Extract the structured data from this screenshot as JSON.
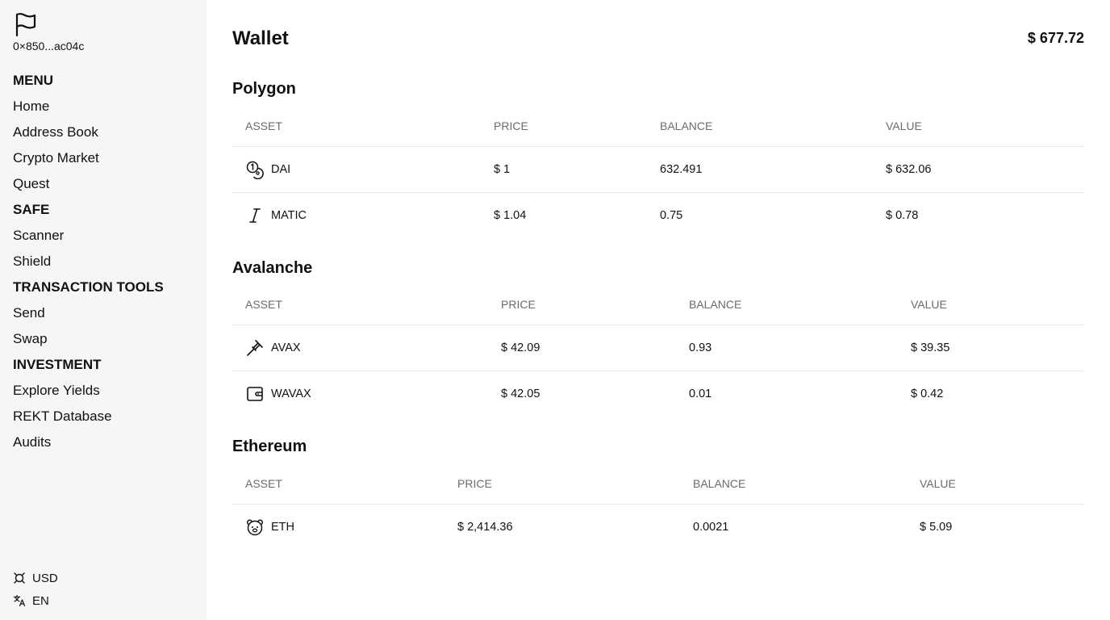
{
  "sidebar": {
    "address": "0×850...ac04c",
    "sections": [
      {
        "heading": "MENU",
        "items": [
          "Home",
          "Address Book",
          "Crypto Market",
          "Quest"
        ]
      },
      {
        "heading": "SAFE",
        "items": [
          "Scanner",
          "Shield"
        ]
      },
      {
        "heading": "TRANSACTION TOOLS",
        "items": [
          "Send",
          "Swap"
        ]
      },
      {
        "heading": "INVESTMENT",
        "items": [
          "Explore Yields",
          "REKT Database",
          "Audits"
        ]
      }
    ],
    "currency": "USD",
    "language": "EN"
  },
  "main": {
    "title": "Wallet",
    "total": "$ 677.72",
    "columns": {
      "asset": "ASSET",
      "price": "PRICE",
      "balance": "BALANCE",
      "value": "VALUE"
    },
    "chains": [
      {
        "name": "Polygon",
        "rows": [
          {
            "icon": "coins-icon",
            "asset": "DAI",
            "price": "$ 1",
            "balance": "632.491",
            "value": "$ 632.06"
          },
          {
            "icon": "italic-icon",
            "asset": "MATIC",
            "price": "$ 1.04",
            "balance": "0.75",
            "value": "$ 0.78"
          }
        ]
      },
      {
        "name": "Avalanche",
        "rows": [
          {
            "icon": "gavel-icon",
            "asset": "AVAX",
            "price": "$ 42.09",
            "balance": "0.93",
            "value": "$ 39.35"
          },
          {
            "icon": "wallet-icon",
            "asset": "WAVAX",
            "price": "$ 42.05",
            "balance": "0.01",
            "value": "$ 0.42"
          }
        ]
      },
      {
        "name": "Ethereum",
        "rows": [
          {
            "icon": "bear-icon",
            "asset": "ETH",
            "price": "$ 2,414.36",
            "balance": "0.0021",
            "value": "$ 5.09"
          }
        ]
      }
    ]
  }
}
